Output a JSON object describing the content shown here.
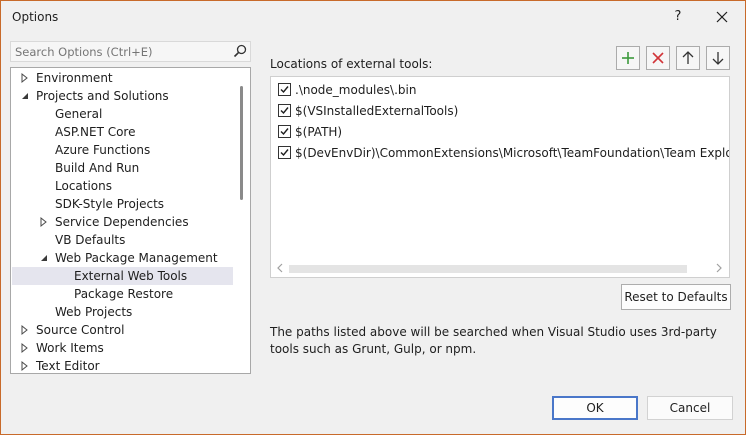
{
  "window": {
    "title": "Options",
    "help_label": "?"
  },
  "search": {
    "placeholder": "Search Options (Ctrl+E)",
    "value": ""
  },
  "tree": {
    "items": [
      {
        "label": "Environment",
        "arrow": "collapsed",
        "selected": false
      },
      {
        "label": "Projects and Solutions",
        "arrow": "expanded",
        "selected": false
      },
      {
        "label": "General",
        "arrow": "none",
        "selected": false
      },
      {
        "label": "ASP.NET Core",
        "arrow": "none",
        "selected": false
      },
      {
        "label": "Azure Functions",
        "arrow": "none",
        "selected": false
      },
      {
        "label": "Build And Run",
        "arrow": "none",
        "selected": false
      },
      {
        "label": "Locations",
        "arrow": "none",
        "selected": false
      },
      {
        "label": "SDK-Style Projects",
        "arrow": "none",
        "selected": false
      },
      {
        "label": "Service Dependencies",
        "arrow": "collapsed",
        "selected": false
      },
      {
        "label": "VB Defaults",
        "arrow": "none",
        "selected": false
      },
      {
        "label": "Web Package Management",
        "arrow": "expanded",
        "selected": false
      },
      {
        "label": "External Web Tools",
        "arrow": "none",
        "selected": true
      },
      {
        "label": "Package Restore",
        "arrow": "none",
        "selected": false
      },
      {
        "label": "Web Projects",
        "arrow": "none",
        "selected": false
      },
      {
        "label": "Source Control",
        "arrow": "collapsed",
        "selected": false
      },
      {
        "label": "Work Items",
        "arrow": "collapsed",
        "selected": false
      },
      {
        "label": "Text Editor",
        "arrow": "collapsed",
        "selected": false
      }
    ]
  },
  "panel": {
    "locations_label": "Locations of external tools:",
    "toolbar": {
      "add_icon": "plus-icon",
      "delete_icon": "delete-x-icon",
      "up_icon": "arrow-up-icon",
      "down_icon": "arrow-down-icon",
      "add_color": "#3c9a3c",
      "delete_color": "#d13438"
    },
    "paths": [
      {
        "path": ".\\node_modules\\.bin",
        "checked": true
      },
      {
        "path": "$(VSInstalledExternalTools)",
        "checked": true
      },
      {
        "path": "$(PATH)",
        "checked": true
      },
      {
        "path": "$(DevEnvDir)\\CommonExtensions\\Microsoft\\TeamFoundation\\Team Explorer\\Git\\",
        "checked": true
      }
    ],
    "reset_label": "Reset to Defaults",
    "description": "The paths listed above will be searched when Visual Studio uses 3rd-party tools such as Grunt, Gulp, or npm."
  },
  "footer": {
    "ok_label": "OK",
    "cancel_label": "Cancel"
  },
  "colors": {
    "accent_border": "#4a77c9",
    "window_border": "#c86a2a",
    "selection": "#e5e5ee"
  }
}
